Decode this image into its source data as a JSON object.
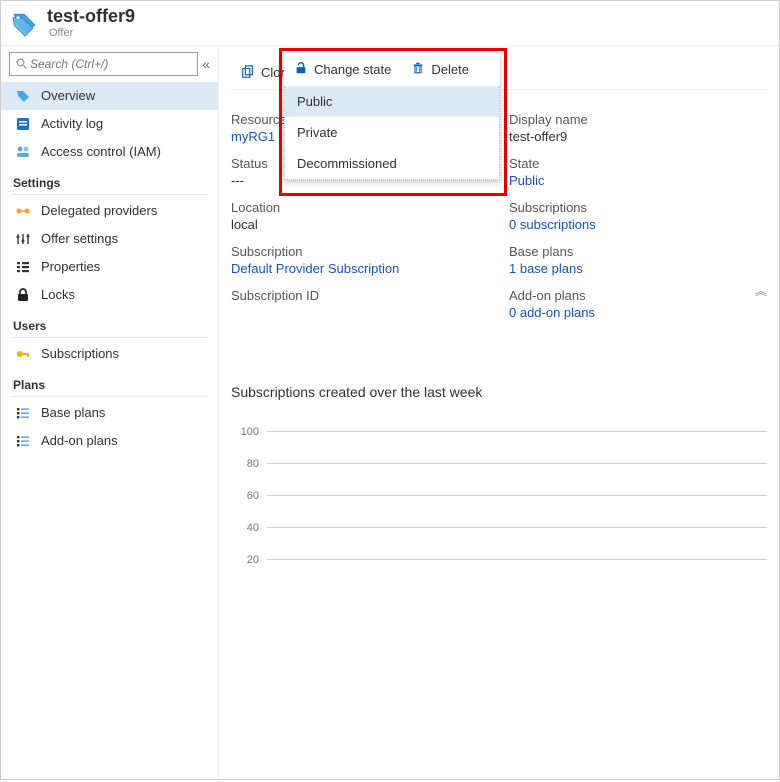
{
  "header": {
    "title": "test-offer9",
    "subtitle": "Offer"
  },
  "search": {
    "placeholder": "Search (Ctrl+/)"
  },
  "nav": {
    "overview": "Overview",
    "activity": "Activity log",
    "iam": "Access control (IAM)",
    "settings_label": "Settings",
    "delegated": "Delegated providers",
    "offer_settings": "Offer settings",
    "properties": "Properties",
    "locks": "Locks",
    "users_label": "Users",
    "subscriptions": "Subscriptions",
    "plans_label": "Plans",
    "base_plans": "Base plans",
    "addon_plans": "Add-on plans"
  },
  "toolbar": {
    "clone": "Clone",
    "change_state": "Change state",
    "delete": "Delete"
  },
  "dropdown": {
    "public": "Public",
    "private": "Private",
    "decom": "Decommissioned"
  },
  "details": {
    "left": [
      {
        "label": "Resource group",
        "value": "myRG1",
        "link": true
      },
      {
        "label": "Status",
        "value": "---"
      },
      {
        "label": "Location",
        "value": "local"
      },
      {
        "label": "Subscription",
        "value": "Default Provider Subscription",
        "link": true
      },
      {
        "label": "Subscription ID",
        "value": ""
      }
    ],
    "right": [
      {
        "label": "Display name",
        "value": "test-offer9"
      },
      {
        "label": "State",
        "value": "Public",
        "link": true
      },
      {
        "label": "Subscriptions",
        "value": "0 subscriptions",
        "link": true
      },
      {
        "label": "Base plans",
        "value": "1 base plans",
        "link": true
      },
      {
        "label": "Add-on plans",
        "value": "0 add-on plans",
        "link": true
      }
    ]
  },
  "chart": {
    "title": "Subscriptions created over the last week"
  },
  "chart_data": {
    "type": "line",
    "title": "Subscriptions created over the last week",
    "y_ticks": [
      100,
      80,
      60,
      40,
      20
    ],
    "ylim": [
      0,
      100
    ],
    "series": [],
    "xlabel": "",
    "ylabel": ""
  }
}
